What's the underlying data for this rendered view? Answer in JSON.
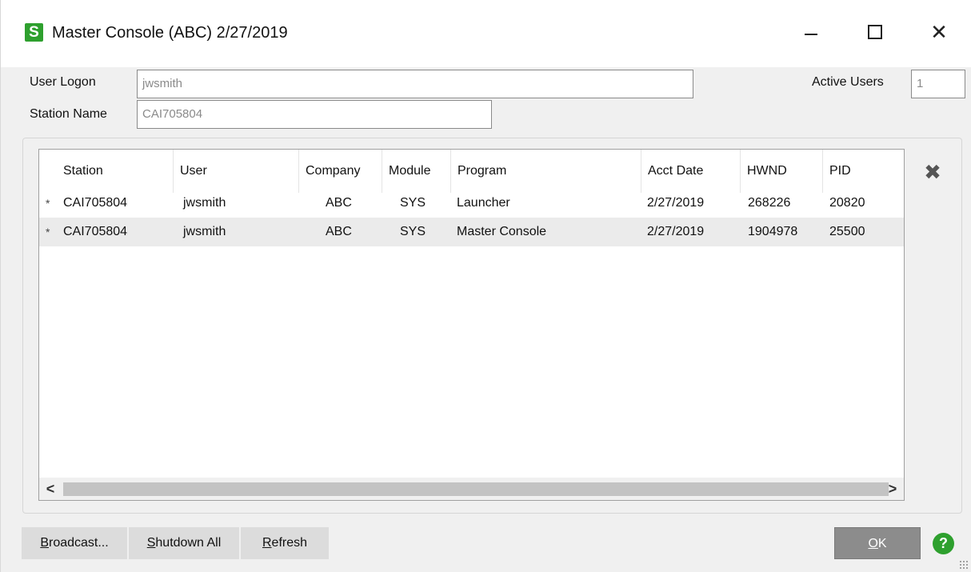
{
  "window": {
    "title": "Master Console (ABC) 2/27/2019",
    "logo_letter": "S",
    "colors": {
      "logo": "#2ea02e",
      "ok_button": "#8c8c8c",
      "help": "#2ea02e"
    }
  },
  "header": {
    "user_logon_label": "User Logon",
    "user_logon_value": "jwsmith",
    "station_name_label": "Station Name",
    "station_name_value": "CAI705804",
    "active_users_label": "Active Users",
    "active_users_value": "1"
  },
  "grid": {
    "columns": [
      "Station",
      "User",
      "Company",
      "Module",
      "Program",
      "Acct Date",
      "HWND",
      "PID"
    ],
    "rows": [
      {
        "marker": "*",
        "station": "CAI705804",
        "user": "jwsmith",
        "company": "ABC",
        "module": "SYS",
        "program": "Launcher",
        "acct_date": "2/27/2019",
        "hwnd": "268226",
        "pid": "20820"
      },
      {
        "marker": "*",
        "station": "CAI705804",
        "user": "jwsmith",
        "company": "ABC",
        "module": "SYS",
        "program": "Master Console",
        "acct_date": "2/27/2019",
        "hwnd": "1904978",
        "pid": "25500"
      }
    ],
    "scroll_left_glyph": "<",
    "scroll_right_glyph": ">",
    "delete_glyph": "✖"
  },
  "footer": {
    "broadcast": {
      "mnemonic": "B",
      "rest": "roadcast..."
    },
    "shutdown_all": {
      "mnemonic": "S",
      "rest": "hutdown All"
    },
    "refresh": {
      "mnemonic": "R",
      "rest": "efresh"
    },
    "ok": {
      "mnemonic": "O",
      "rest": "K"
    },
    "help_glyph": "?"
  }
}
